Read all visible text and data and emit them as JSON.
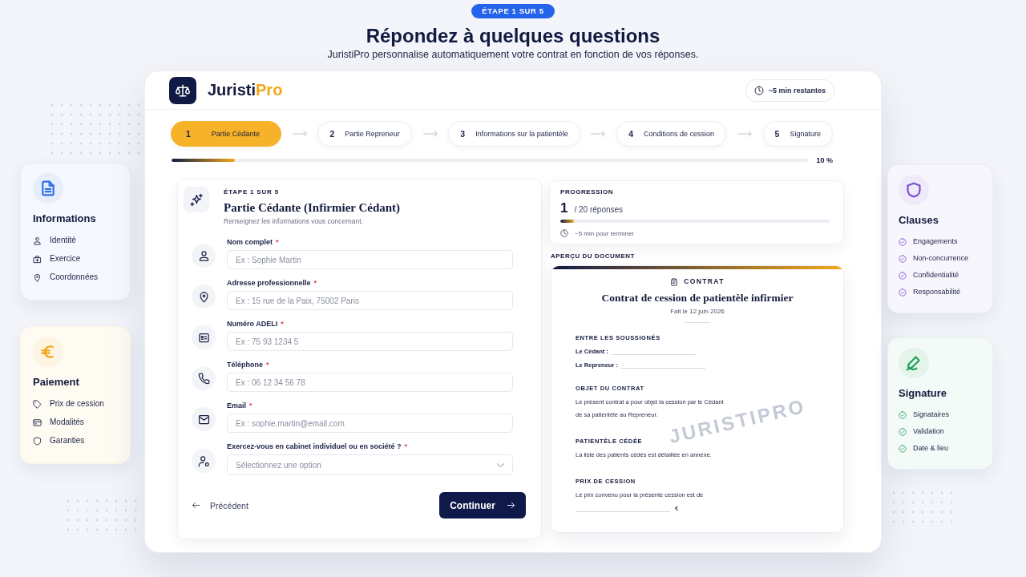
{
  "intro": {
    "badge": "ÉTAPE 1 SUR 5",
    "title": "Répondez à quelques questions",
    "subtitle": "JuristiPro personnalise automatiquement votre contrat en fonction de vos réponses."
  },
  "side_cards_left": [
    {
      "title": "Informations",
      "color": "#2f6fe4",
      "items": [
        "Identité",
        "Exercice",
        "Coordonnées"
      ]
    },
    {
      "title": "Paiement",
      "color": "#f2a516",
      "items": [
        "Prix de cession",
        "Modalités",
        "Garanties"
      ]
    }
  ],
  "app": {
    "brand": {
      "name": "Juristi",
      "accent": "Pro"
    },
    "time_left": "~5 min restantes",
    "steps": [
      {
        "number": "1",
        "label": "Partie Cédante",
        "selected": true
      },
      {
        "number": "2",
        "label": "Partie Repreneur",
        "selected": false
      },
      {
        "number": "3",
        "label": "Informations sur la patientèle",
        "selected": false
      },
      {
        "number": "4",
        "label": "Conditions de cession",
        "selected": false
      },
      {
        "number": "5",
        "label": "Signature",
        "selected": false
      }
    ],
    "progress": {
      "level": 0.1,
      "label": "10 %"
    },
    "form": {
      "eyebrow": "ÉTAPE 1 SUR 5",
      "title": "Partie Cédante (Infirmier Cédant)",
      "subtitle": "Renseignez les informations vous concernant.",
      "fields": [
        {
          "kind": "text",
          "label": "Nom complet",
          "marker": "*",
          "placeholder": "Ex : Sophie Martin"
        },
        {
          "kind": "text",
          "label": "Adresse professionnelle",
          "marker": "*",
          "placeholder": "Ex : 15 rue de la Paix, 75002 Paris"
        },
        {
          "kind": "text",
          "label": "Numéro ADELI",
          "marker": "*",
          "placeholder": "Ex : 75 93 1234 5"
        },
        {
          "kind": "text",
          "label": "Téléphone",
          "marker": "*",
          "placeholder": "Ex : 06 12 34 56 78"
        },
        {
          "kind": "text",
          "label": "Email",
          "marker": "*",
          "placeholder": "Ex : sophie.martin@email.com"
        },
        {
          "kind": "select",
          "label": "Exercez-vous en cabinet individuel ou en société ?",
          "marker": "*",
          "placeholder": "Sélectionnez une option"
        }
      ],
      "back": "Précédent",
      "next": "Continuer"
    },
    "progression": {
      "heading": "PROGRESSION",
      "count": "1",
      "total": "/ 20 réponses",
      "level": 0.05,
      "eta": "~5 min pour terminer"
    },
    "preview": {
      "heading": "APERÇU DU DOCUMENT",
      "document": {
        "eyebrow": "CONTRAT",
        "title": "Contrat de cession de patientèle infirmier",
        "date": "Fait le 12 juin 2026",
        "watermark": "JURISTIPRO",
        "parties_heading": "ENTRE LES SOUSSIGNÉS",
        "parties": [
          "Le Cédant :",
          "Le Repreneur :"
        ],
        "sections": [
          {
            "heading": "OBJET DU CONTRAT",
            "text": "Le présent contrat a pour objet la cession par le Cédant de sa patientèle au Repreneur."
          },
          {
            "heading": "PATIENTÈLE CÉDÉE",
            "text": "La liste des patients cédés est détaillée en annexe."
          },
          {
            "heading": "PRIX DE CESSION",
            "text": "Le prix convenu pour la présente cession est de",
            "unit": "€"
          }
        ]
      }
    }
  },
  "side_cards_right": [
    {
      "title": "Clauses",
      "color": "#7c4fd0",
      "items": [
        "Engagements",
        "Non-concurrence",
        "Confidentialité",
        "Responsabilité"
      ]
    },
    {
      "title": "Signature",
      "color": "#22a05a",
      "items": [
        "Signataires",
        "Validation",
        "Date & lieu"
      ]
    }
  ]
}
